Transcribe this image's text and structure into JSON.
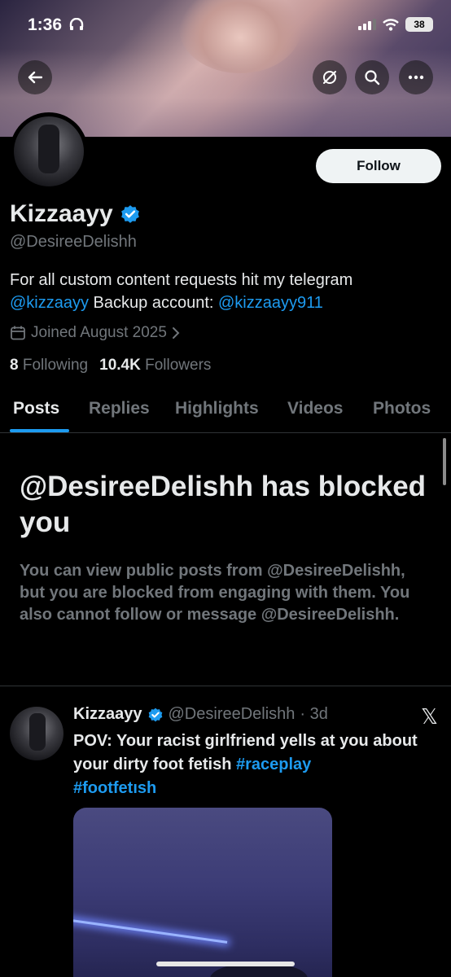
{
  "status_bar": {
    "time": "1:36",
    "battery": "38"
  },
  "profile": {
    "display_name": "Kizzaayy",
    "handle": "@DesireeDelishh",
    "follow_label": "Follow",
    "bio_line1": "For all custom content requests hit my telegram",
    "bio_link1": "@kizzaayy",
    "bio_middle": " Backup account: ",
    "bio_link2": "@kizzaayy911",
    "joined": "Joined August 2025",
    "following_count": "8",
    "following_label": "Following",
    "followers_count": "10.4K",
    "followers_label": "Followers"
  },
  "tabs": [
    {
      "label": "Posts",
      "active": true
    },
    {
      "label": "Replies"
    },
    {
      "label": "Highlights"
    },
    {
      "label": "Videos"
    },
    {
      "label": "Photos"
    }
  ],
  "blocked_notice": {
    "title": "@DesireeDelishh has blocked you",
    "message": "You can view public posts from @DesireeDelishh, but you are blocked from engaging with them. You also cannot follow or message @DesireeDelishh."
  },
  "post": {
    "name": "Kizzaayy",
    "handle": "@DesireeDelishh",
    "time": "· 3d",
    "text_plain": "POV: Your racist girlfriend yells at you about your dirty foot fetish ",
    "hashtag1": "#raceplay",
    "hashtag2": "#footfetısh"
  },
  "colors": {
    "accent": "#1d9bf0",
    "background": "#000000",
    "muted": "#71767b",
    "text": "#e7e9ea"
  },
  "icons": [
    "back-arrow-icon",
    "hide-icon",
    "search-icon",
    "more-icon",
    "verified-badge-icon",
    "calendar-icon",
    "chevron-right-icon",
    "x-logo-icon",
    "signal-icon",
    "wifi-icon",
    "headphones-icon"
  ]
}
